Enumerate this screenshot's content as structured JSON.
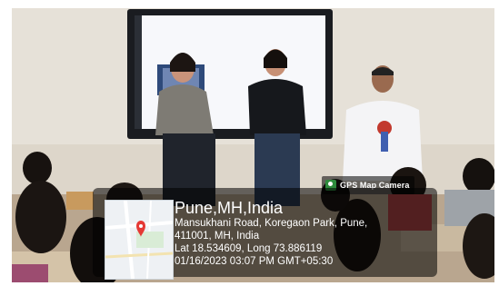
{
  "gps_overlay": {
    "badge_label": "GPS Map Camera",
    "badge_icon": "map-camera-icon",
    "location_title": "Pune,MH,India",
    "address_line1": "Mansukhani Road, Koregaon Park, Pune,",
    "address_line2": "411001, MH, India",
    "coordinates": "Lat 18.534609, Long 73.886119",
    "datetime": "01/16/2023 03:07 PM GMT+05:30",
    "map_icon": "map-pin-icon"
  },
  "colors": {
    "overlay_background": "#000000",
    "overlay_text": "#ffffff",
    "map_pin": "#e53935"
  }
}
